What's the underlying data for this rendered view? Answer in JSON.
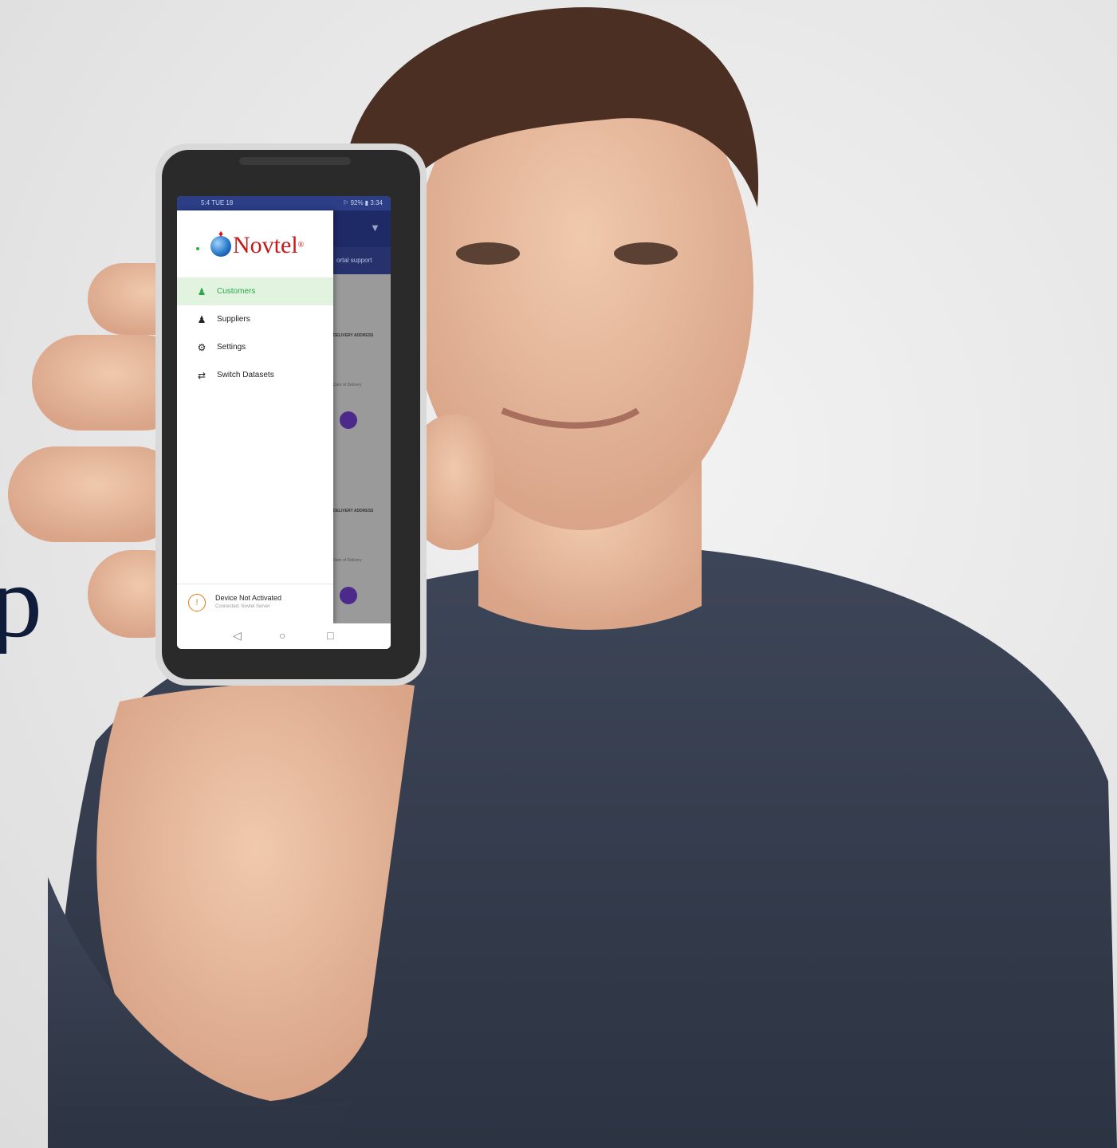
{
  "headline_fragment": "p",
  "phone": {
    "status_bar": {
      "time": "5:4 TUE 18",
      "icons": "⚐ 92% ▮ 3:34"
    },
    "background_app": {
      "tab_text": "ortal support",
      "cards": [
        {
          "heading": "DELIVERY ADDRESS",
          "footer": "Date of Delivery"
        },
        {
          "heading": "DELIVERY ADDRESS",
          "footer": "Date of Delivery"
        }
      ]
    },
    "drawer": {
      "logo_text": "Novtel",
      "logo_mark": "®",
      "menu": [
        {
          "label": "Customers",
          "icon": "person-icon",
          "active": true
        },
        {
          "label": "Suppliers",
          "icon": "person-tie-icon",
          "active": false
        },
        {
          "label": "Settings",
          "icon": "gear-icon",
          "active": false
        },
        {
          "label": "Switch Datasets",
          "icon": "swap-icon",
          "active": false
        }
      ],
      "footer": {
        "title": "Device Not Activated",
        "subtitle": "Connected: Novtel Server"
      }
    },
    "nav": {
      "back": "◁",
      "home": "○",
      "recent": "□"
    }
  },
  "colors": {
    "accent_green": "#2aa84a",
    "appbar_navy": "#1e2a66",
    "logo_red": "#c41a1a",
    "warning_orange": "#e07b1a"
  }
}
